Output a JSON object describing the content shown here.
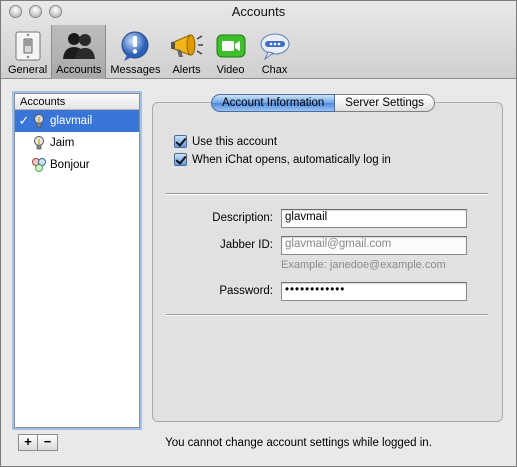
{
  "window": {
    "title": "Accounts"
  },
  "toolbar": {
    "items": [
      {
        "label": "General",
        "icon": "switch-icon",
        "active": false
      },
      {
        "label": "Accounts",
        "icon": "people-icon",
        "active": true
      },
      {
        "label": "Messages",
        "icon": "exclamation-bubble-icon",
        "active": false
      },
      {
        "label": "Alerts",
        "icon": "megaphone-icon",
        "active": false
      },
      {
        "label": "Video",
        "icon": "video-camera-icon",
        "active": false
      },
      {
        "label": "Chax",
        "icon": "chat-bubble-icon",
        "active": false
      }
    ]
  },
  "accounts": {
    "header": "Accounts",
    "items": [
      {
        "label": "glavmail",
        "selected": true,
        "checked": "✓",
        "icon": "lightbulb-icon"
      },
      {
        "label": "Jaim",
        "selected": false,
        "checked": "",
        "icon": "lightbulb-icon"
      },
      {
        "label": "Bonjour",
        "selected": false,
        "checked": "",
        "icon": "bonjour-icon"
      }
    ],
    "add_label": "+",
    "remove_label": "−"
  },
  "tabs": {
    "account_information": "Account Information",
    "server_settings": "Server Settings",
    "active": "account_information"
  },
  "options": {
    "use_account": "Use this account",
    "auto_login": "When iChat opens, automatically log in"
  },
  "fields": {
    "description_label": "Description:",
    "description_value": "glavmail",
    "jabber_label": "Jabber ID:",
    "jabber_value": "glavmail@gmail.com",
    "jabber_hint": "Example: janedoe@example.com",
    "password_label": "Password:",
    "password_value": "••••••••••••"
  },
  "status": "You cannot change account settings while logged in.",
  "colors": {
    "selection": "#3875d7",
    "accent_blue": "#4a8ae0"
  }
}
